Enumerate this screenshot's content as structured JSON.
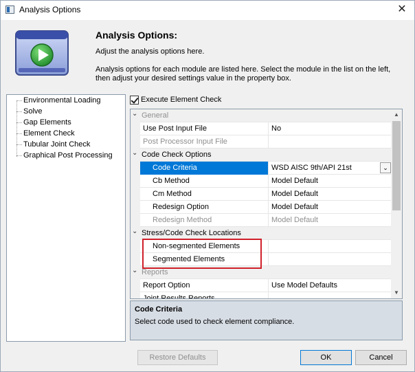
{
  "window": {
    "title": "Analysis Options"
  },
  "banner": {
    "title": "Analysis Options:",
    "subtitle": "Adjust the analysis options here.",
    "description": "Analysis options for each module are listed here. Select the module in the list on the left, then adjust your desired settings value in the property box."
  },
  "tree": {
    "items": [
      "Environmental Loading",
      "Solve",
      "Gap Elements",
      "Element Check",
      "Tubular Joint Check",
      "Graphical Post Processing"
    ]
  },
  "execute_check": {
    "label": "Execute Element Check",
    "checked": true
  },
  "grid": {
    "rows": [
      {
        "type": "category",
        "name": "General",
        "expander": "⌄",
        "gray": true
      },
      {
        "type": "prop",
        "name": "Use Post Input File",
        "value": "No"
      },
      {
        "type": "prop",
        "name": "Post Processor Input File",
        "value": "",
        "gray": true
      },
      {
        "type": "category",
        "name": "Code Check Options",
        "expander": "⌄"
      },
      {
        "type": "prop",
        "name": "Code Criteria",
        "value": "WSD AISC 9th/API 21st",
        "indent": true,
        "selected": true,
        "combo": true
      },
      {
        "type": "prop",
        "name": "Cb Method",
        "value": "Model Default",
        "indent": true
      },
      {
        "type": "prop",
        "name": "Cm Method",
        "value": "Model Default",
        "indent": true
      },
      {
        "type": "prop",
        "name": "Redesign Option",
        "value": "Model Default",
        "indent": true
      },
      {
        "type": "prop",
        "name": "Redesign Method",
        "value": "Model Default",
        "indent": true,
        "gray": true
      },
      {
        "type": "category",
        "name": "Stress/Code Check Locations",
        "expander": "⌄"
      },
      {
        "type": "prop",
        "name": "Non-segmented Elements",
        "value": "",
        "indent": true
      },
      {
        "type": "prop",
        "name": "Segmented Elements",
        "value": "",
        "indent": true
      },
      {
        "type": "category",
        "name": "Reports",
        "expander": "⌄",
        "gray": true
      },
      {
        "type": "prop",
        "name": "Report Option",
        "value": "Use Model Defaults"
      },
      {
        "type": "prop",
        "name": "Joint Results Reports",
        "value": "",
        "gray": false
      }
    ]
  },
  "help": {
    "title": "Code Criteria",
    "text": "Select code used to check element compliance."
  },
  "buttons": {
    "restore": "Restore Defaults",
    "ok": "OK",
    "cancel": "Cancel"
  },
  "icons": {
    "close": "close-icon",
    "app": "app-icon",
    "banner": "play-window-icon",
    "combo": "chevron-down-icon"
  },
  "colors": {
    "selection": "#0078d7",
    "highlight_box": "#d0202a",
    "help_bg": "#d7dde5"
  }
}
